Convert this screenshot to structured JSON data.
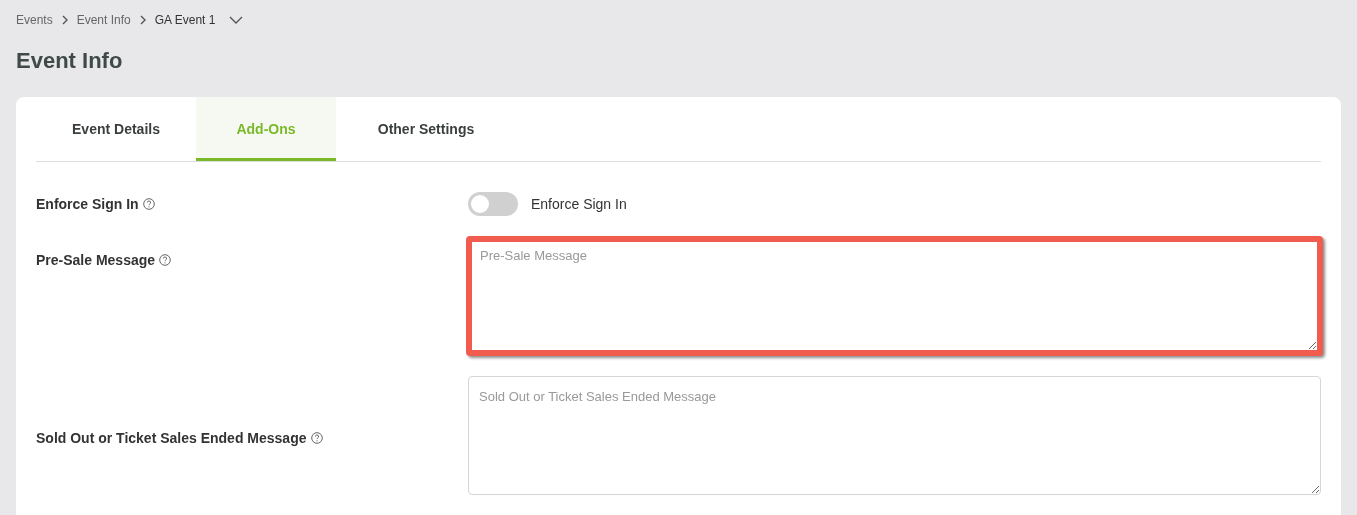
{
  "breadcrumb": {
    "items": [
      {
        "label": "Events"
      },
      {
        "label": "Event Info"
      }
    ],
    "current": "GA Event 1"
  },
  "title": "Event Info",
  "tabs": [
    {
      "label": "Event Details",
      "selected": false
    },
    {
      "label": "Add-Ons",
      "selected": true
    },
    {
      "label": "Other Settings",
      "selected": false
    }
  ],
  "fields": [
    {
      "kind": "toggle",
      "label": "Enforce Sign In",
      "on": false,
      "toggle_label": "Enforce Sign In"
    },
    {
      "kind": "textarea",
      "label": "Pre-Sale Message",
      "placeholder": "Pre-Sale Message",
      "highlighted": true
    },
    {
      "kind": "textarea",
      "label": "Sold Out or Ticket Sales Ended Message",
      "placeholder": "Sold Out or Ticket Sales Ended Message",
      "highlighted": false
    }
  ]
}
